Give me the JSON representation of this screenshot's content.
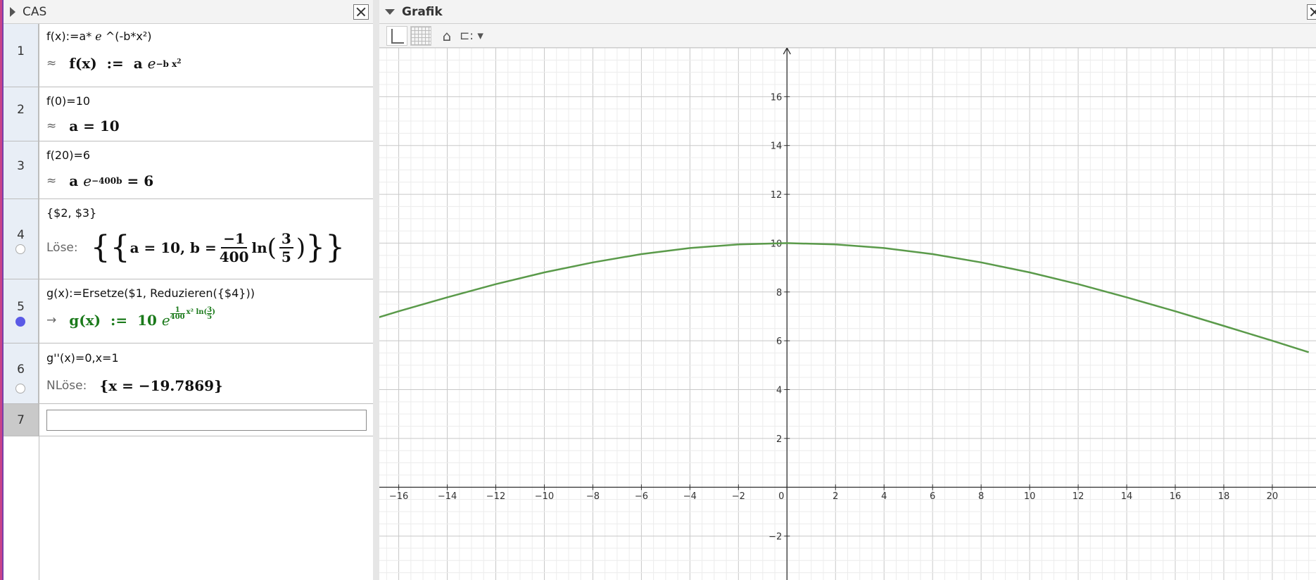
{
  "cas": {
    "title": "CAS",
    "rows": [
      {
        "number": "1",
        "input": "f(x):=a* ℯ ^(-b*x²)",
        "prefix": "≈",
        "out_name": "f(x)",
        "out_assign": ":=",
        "out_coef": "a",
        "out_e": "e",
        "out_exp": "−b x",
        "out_exp2": "2"
      },
      {
        "number": "2",
        "input": "f(0)=10",
        "prefix": "≈",
        "output": "a = 10"
      },
      {
        "number": "3",
        "input": "f(20)=6",
        "prefix": "≈",
        "out_coef": "a",
        "out_e": "e",
        "out_exp": "−400b",
        "out_rhs": "= 6"
      },
      {
        "number": "4",
        "input": "{$2, $3}",
        "prefix": "Löse:",
        "out_a": "a = 10,",
        "out_b": "b =",
        "frac_num": "−1",
        "frac_den": "400",
        "out_ln": "ln",
        "ln_num": "3",
        "ln_den": "5"
      },
      {
        "number": "5",
        "input": "g(x):=Ersetze($1, Reduzieren({$4}))",
        "prefix": "→",
        "out_name": "g(x)",
        "out_assign": ":=",
        "out_coef": "10",
        "out_e": "e",
        "out_exp": "1",
        "out_exp_den": "400",
        "out_exp_rest": "x² ln(",
        "out_exp_num2": "3",
        "out_exp_den2": "5",
        "out_exp_close": ")"
      },
      {
        "number": "6",
        "input": "g''(x)=0,x=1",
        "prefix": "NLöse:",
        "output": "{x = −19.7869}"
      },
      {
        "number": "7",
        "input": ""
      }
    ]
  },
  "grafik": {
    "title": "Grafik",
    "curve_color": "#5a9a4a"
  },
  "chart_data": {
    "type": "line",
    "function": "g(x) = 10 * e^((1/400) * x^2 * ln(3/5))",
    "series": [
      {
        "values": [
          [
            -17,
            6.91
          ],
          [
            -16,
            7.21
          ],
          [
            -14,
            7.78
          ],
          [
            -12,
            8.32
          ],
          [
            -10,
            8.8
          ],
          [
            -8,
            9.21
          ],
          [
            -6,
            9.55
          ],
          [
            -4,
            9.8
          ],
          [
            -2,
            9.95
          ],
          [
            0,
            10
          ],
          [
            2,
            9.95
          ],
          [
            4,
            9.8
          ],
          [
            6,
            9.55
          ],
          [
            8,
            9.21
          ],
          [
            10,
            8.8
          ],
          [
            12,
            8.32
          ],
          [
            14,
            7.78
          ],
          [
            16,
            7.21
          ],
          [
            18,
            6.61
          ],
          [
            20,
            6.0
          ],
          [
            21.5,
            5.53
          ]
        ]
      }
    ],
    "x_ticks": [
      "−16",
      "−14",
      "−12",
      "−10",
      "−8",
      "−6",
      "−4",
      "−2",
      "0",
      "2",
      "4",
      "6",
      "8",
      "10",
      "12",
      "14",
      "16",
      "18",
      "20"
    ],
    "y_ticks": [
      "−2",
      "2",
      "4",
      "6",
      "8",
      "10",
      "12",
      "14",
      "16"
    ],
    "xlim": [
      -16.8,
      21.8
    ],
    "ylim": [
      -3.8,
      18.0
    ],
    "grid": true
  }
}
